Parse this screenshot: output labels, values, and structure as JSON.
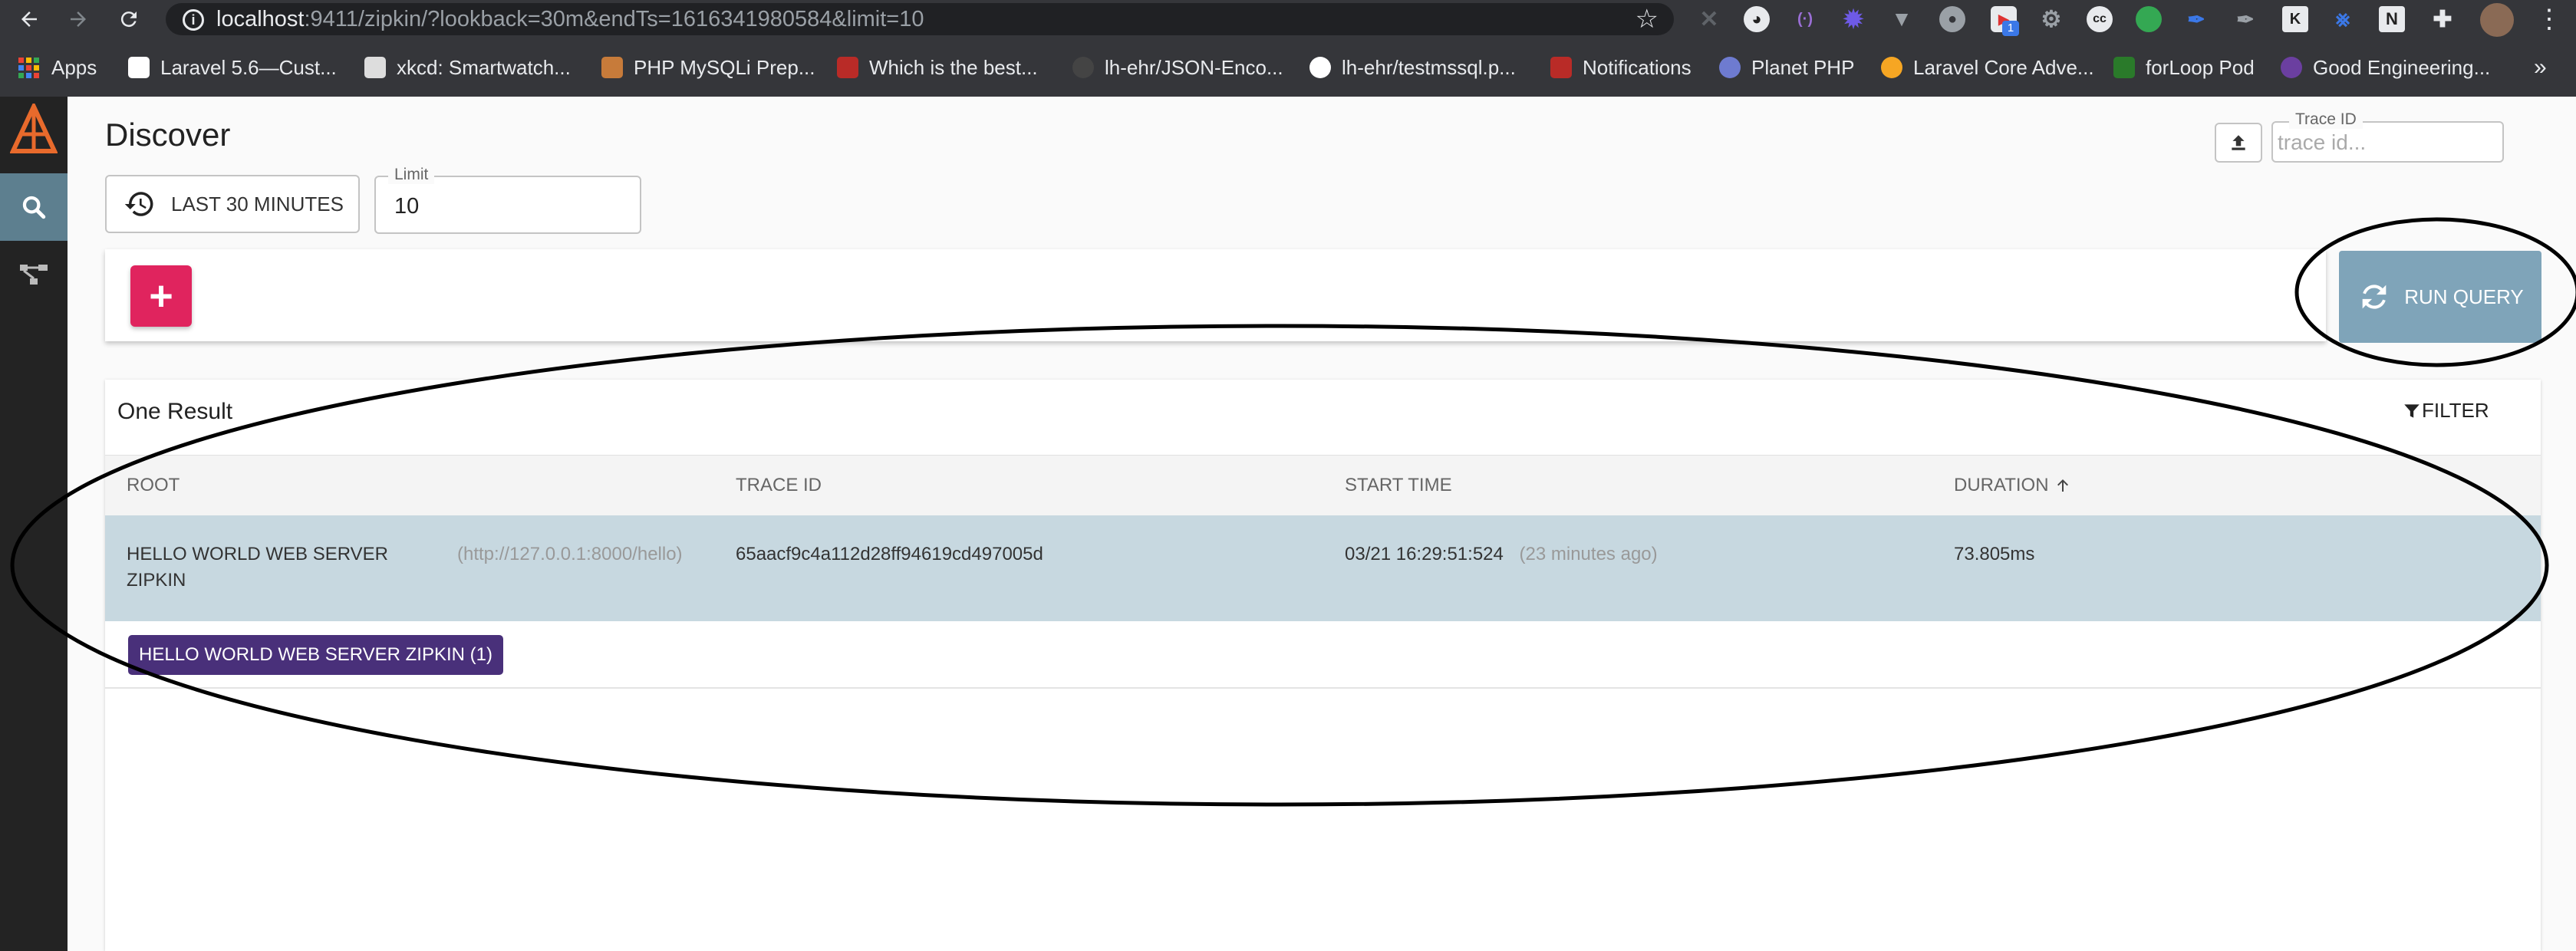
{
  "browser": {
    "url_host": "localhost",
    "url_path": ":9411/zipkin/?lookback=30m&endTs=1616341980584&limit=10",
    "bookmarks": [
      {
        "label": "Apps",
        "color": "#ea4335"
      },
      {
        "label": "Laravel 5.6—Cust...",
        "color": "#ffffff"
      },
      {
        "label": "xkcd: Smartwatch...",
        "color": "#dddddd"
      },
      {
        "label": "PHP MySQLi Prep...",
        "color": "#c77b3a"
      },
      {
        "label": "Which is the best...",
        "color": "#b92b27"
      },
      {
        "label": "lh-ehr/JSON-Enco...",
        "color": "#444444"
      },
      {
        "label": "lh-ehr/testmssql.p...",
        "color": "#ffffff"
      },
      {
        "label": "Notifications",
        "color": "#b92b27"
      },
      {
        "label": "Planet PHP",
        "color": "#6e7bd0"
      },
      {
        "label": "Laravel Core Adve...",
        "color": "#f6a623"
      },
      {
        "label": "forLoop Pod",
        "color": "#2a7a2a"
      },
      {
        "label": "Good Engineering...",
        "color": "#6b3fa0"
      }
    ],
    "ext_badge": "1"
  },
  "app": {
    "title": "Discover",
    "lookback_label": "LAST 30 MINUTES",
    "limit_label": "Limit",
    "limit_value": "10",
    "trace_id_label": "Trace ID",
    "trace_id_placeholder": "trace id...",
    "add_label": "+",
    "run_query_label": "RUN QUERY"
  },
  "results": {
    "summary": "One Result",
    "filter_label": "FILTER",
    "columns": [
      "ROOT",
      "TRACE ID",
      "START TIME",
      "DURATION"
    ],
    "rows": [
      {
        "root_line1": "HELLO WORLD WEB SERVER",
        "root_line2": "ZIPKIN",
        "root_url": "(http://127.0.0.1:8000/hello)",
        "trace_id": "65aacf9c4a112d28ff94619cd497005d",
        "start_time": "03/21 16:29:51:524",
        "start_relative": "(23 minutes ago)",
        "duration": "73.805ms",
        "service_badge": "HELLO WORLD WEB SERVER ZIPKIN (1)"
      }
    ]
  },
  "colors": {
    "accent_pink": "#e0245e",
    "run_query_bg": "#7fa4b9",
    "row_highlight": "#c7d8e0",
    "badge_purple": "#49307a",
    "nav_dark": "#232323",
    "nav_active": "#5d7f8f"
  }
}
